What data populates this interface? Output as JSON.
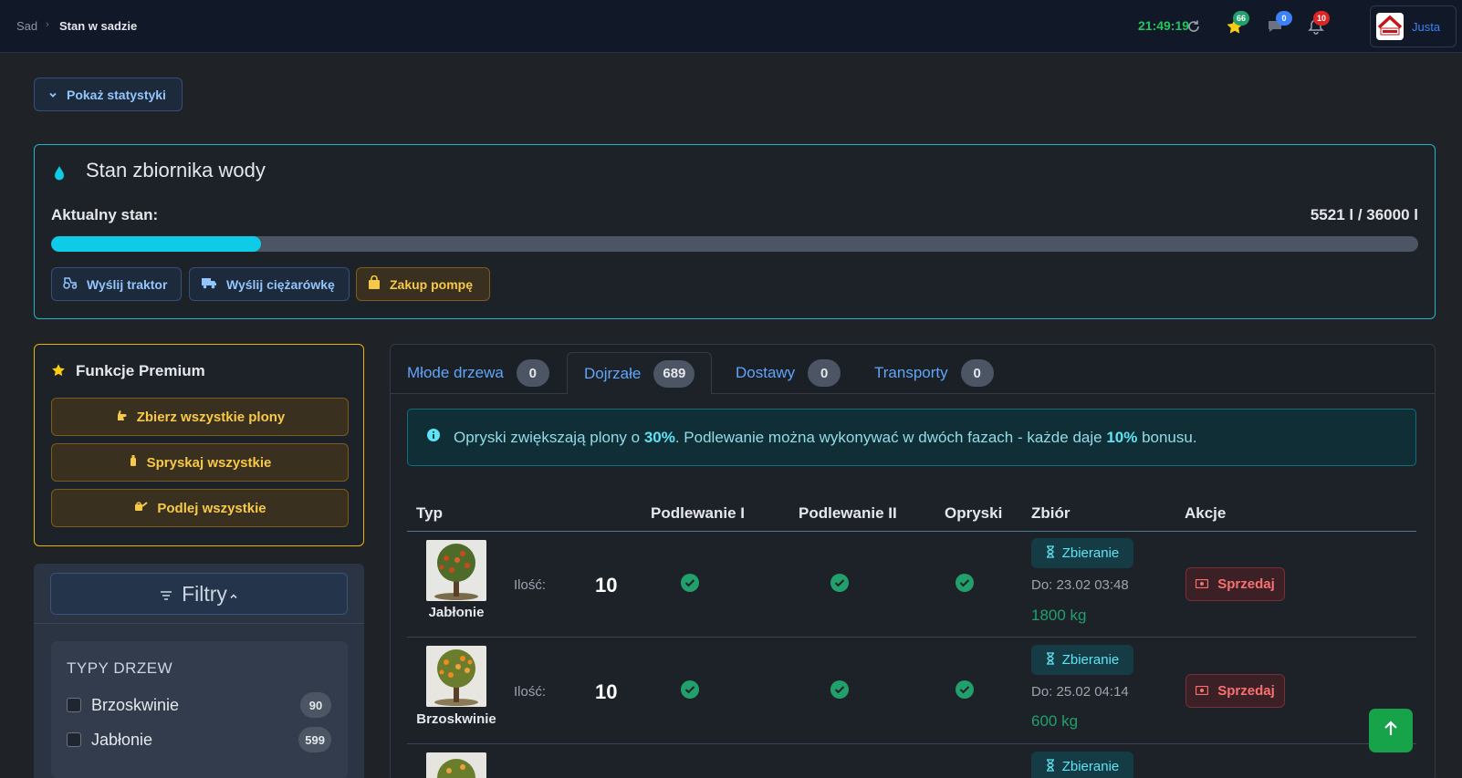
{
  "breadcrumb": {
    "parent": "Sad",
    "separator": "›",
    "current": "Stan w sadzie"
  },
  "topbar": {
    "time": "21:49:19",
    "badges": {
      "stars": "66",
      "messages": "0",
      "notifications": "10"
    },
    "username": "Justa",
    "icons": [
      "refresh-icon",
      "star-icon",
      "chat-icon",
      "bell-icon"
    ]
  },
  "stats_button": "Pokaż statystyki",
  "water": {
    "title": "Stan zbiornika wody",
    "label": "Aktualny stan:",
    "value": "5521 l / 36000 l",
    "fill_fraction": 0.1534,
    "buttons": {
      "tractor": "Wyślij traktor",
      "truck": "Wyślij ciężarówkę",
      "pump": "Zakup pompę"
    }
  },
  "premium": {
    "title": "Funkcje Premium",
    "buttons": {
      "harvest": "Zbierz wszystkie plony",
      "spray": "Spryskaj wszystkie",
      "water": "Podlej wszystkie"
    }
  },
  "filters": {
    "title": "Filtry",
    "types_title": "TYPY DRZEW",
    "types": [
      {
        "name": "Brzoskwinie",
        "count": "90"
      },
      {
        "name": "Jabłonie",
        "count": "599"
      }
    ]
  },
  "tabs": [
    {
      "label": "Młode drzewa",
      "count": "0"
    },
    {
      "label": "Dojrzałe",
      "count": "689"
    },
    {
      "label": "Dostawy",
      "count": "0"
    },
    {
      "label": "Transporty",
      "count": "0"
    }
  ],
  "info": {
    "part1": "Opryski zwiększają plony o ",
    "bold1": "30%",
    "part2": ". Podlewanie można wykonywać w dwóch fazach - każde daje ",
    "bold2": "10%",
    "part3": " bonusu."
  },
  "table": {
    "headers": {
      "type": "Typ",
      "water1": "Podlewanie I",
      "water2": "Podlewanie II",
      "spray": "Opryski",
      "harvest": "Zbiór",
      "actions": "Akcje"
    },
    "qty_label": "Ilość:",
    "harvest_label": "Zbieranie",
    "sell_label": "Sprzedaj",
    "rows": [
      {
        "name": "Jabłonie",
        "qty": "10",
        "due": "Do: 23.02 03:48",
        "kg": "1800 kg"
      },
      {
        "name": "Brzoskwinie",
        "qty": "10",
        "due": "Do: 25.02 04:14",
        "kg": "600 kg"
      },
      {
        "name": "",
        "qty": "",
        "due": "",
        "kg": ""
      }
    ]
  },
  "colors": {
    "accent": "#0ecbe8",
    "success": "#22a06b",
    "warning": "#f7c948",
    "danger": "#f87171",
    "link": "#60a5fa"
  }
}
